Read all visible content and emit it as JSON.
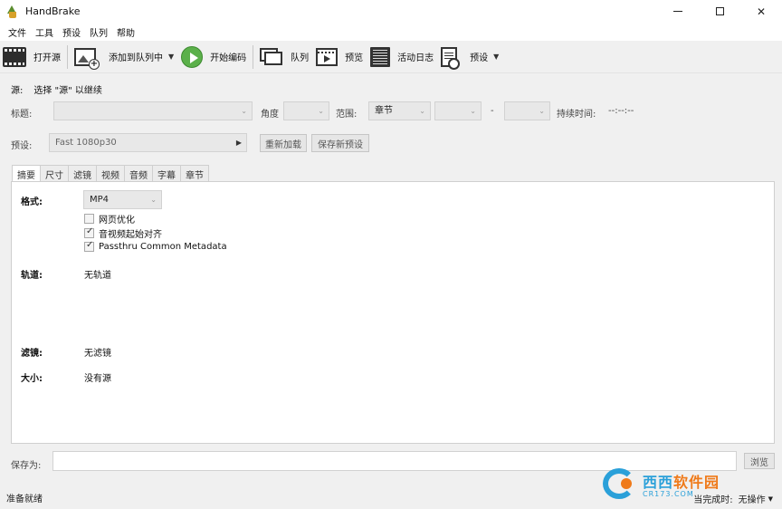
{
  "window": {
    "title": "HandBrake"
  },
  "menu": [
    "文件",
    "工具",
    "预设",
    "队列",
    "帮助"
  ],
  "toolbar": {
    "open_source": "打开源",
    "add_to_queue": "添加到队列中",
    "start_encode": "开始编码",
    "queue": "队列",
    "preview": "预览",
    "activity_log": "活动日志",
    "presets": "预设"
  },
  "source": {
    "label": "源:",
    "value": "选择 \"源\" 以继续"
  },
  "title_row": {
    "title_label": "标题:",
    "angle_label": "角度",
    "range_label": "范围:",
    "range_value": "章节",
    "range_dash": "-",
    "duration_label": "持续时间:",
    "duration_value": "--:--:--"
  },
  "preset_row": {
    "label": "预设:",
    "value": "Fast 1080p30",
    "reload": "重新加载",
    "save_new": "保存新预设"
  },
  "tabs": [
    "摘要",
    "尺寸",
    "滤镜",
    "视频",
    "音频",
    "字幕",
    "章节"
  ],
  "summary": {
    "format_label": "格式:",
    "format_value": "MP4",
    "web_optimized": "网页优化",
    "align_av": "音视频起始对齐",
    "passthru_metadata": "Passthru Common Metadata",
    "tracks_label": "轨道:",
    "tracks_value": "无轨道",
    "filters_label": "滤镜:",
    "filters_value": "无滤镜",
    "size_label": "大小:",
    "size_value": "没有源"
  },
  "save": {
    "label": "保存为:",
    "browse": "浏览"
  },
  "status": {
    "left": "准备就绪",
    "when_done_label": "当完成时:",
    "when_done_value": "无操作"
  },
  "watermark": {
    "name_blue": "西西",
    "name_orange": "软件园",
    "url": "CR173.COM"
  },
  "icons": {
    "app": "handbrake-icon",
    "open_source": "film-clapper-icon",
    "add_to_queue": "photo-add-icon",
    "start_encode": "play-icon",
    "queue": "photo-stack-icon",
    "preview": "film-frame-icon",
    "activity_log": "terminal-log-icon",
    "presets": "document-gear-icon"
  },
  "colors": {
    "play_green": "#5bb04a",
    "watermark_blue": "#2aa0d9",
    "watermark_orange": "#ef7a1a"
  }
}
